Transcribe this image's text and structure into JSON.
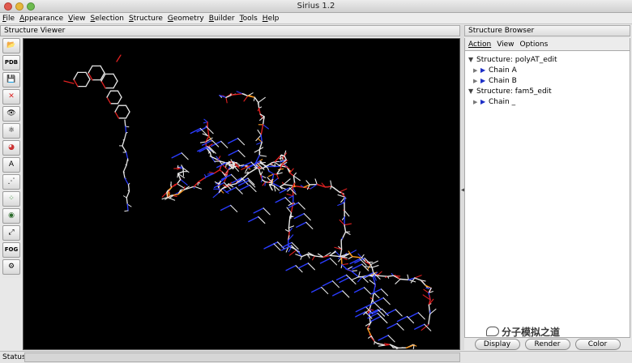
{
  "window": {
    "title": "Sirius 1.2"
  },
  "menubar": {
    "items": [
      "File",
      "Appearance",
      "View",
      "Selection",
      "Structure",
      "Geometry",
      "Builder",
      "Tools",
      "Help"
    ]
  },
  "viewer": {
    "title": "Structure Viewer"
  },
  "toolbar": {
    "tools": [
      {
        "name": "open-folder-icon",
        "glyph": "📂"
      },
      {
        "name": "open-pdb-icon",
        "glyph": "PDB"
      },
      {
        "name": "save-disk-icon",
        "glyph": "💾"
      },
      {
        "name": "close-x-icon",
        "glyph": "✕"
      },
      {
        "name": "eye-icon",
        "glyph": "👁"
      },
      {
        "name": "molecule-icon",
        "glyph": "⚛"
      },
      {
        "name": "color-wheel-icon",
        "glyph": "◕"
      },
      {
        "name": "label-atom-icon",
        "glyph": "A"
      },
      {
        "name": "measure-icon",
        "glyph": "⋰"
      },
      {
        "name": "selection-atoms-icon",
        "glyph": "⁘"
      },
      {
        "name": "selection-sphere-icon",
        "glyph": "◉"
      },
      {
        "name": "fit-expand-icon",
        "glyph": "⤢"
      },
      {
        "name": "fog-icon",
        "glyph": "FOG"
      },
      {
        "name": "settings-gear-icon",
        "glyph": "⚙"
      }
    ]
  },
  "browser": {
    "title": "Structure Browser",
    "menu": [
      "Action",
      "View",
      "Options"
    ],
    "tree": [
      {
        "level": 0,
        "expanded": true,
        "label": "Structure: polyAT_edit"
      },
      {
        "level": 1,
        "expanded": false,
        "label": "Chain A"
      },
      {
        "level": 1,
        "expanded": false,
        "label": "Chain B"
      },
      {
        "level": 0,
        "expanded": true,
        "label": "Structure: fam5_edit"
      },
      {
        "level": 1,
        "expanded": false,
        "label": "Chain _"
      }
    ],
    "buttons": {
      "display": "Display",
      "render": "Render",
      "color": "Color"
    }
  },
  "status": {
    "label": "Status:",
    "value": ""
  },
  "watermark": {
    "text": "分子模拟之道"
  },
  "colors": {
    "bond_white": "#e6e6e6",
    "oxygen_red": "#e02020",
    "nitrogen_blue": "#2a3cff",
    "phosphorus_orange": "#ff9a1e",
    "background": "#000000"
  }
}
